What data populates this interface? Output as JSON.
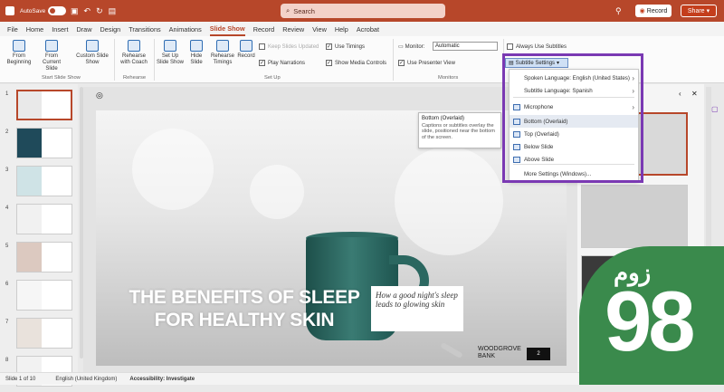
{
  "titlebar": {
    "autosave": "AutoSave",
    "search_placeholder": "Search",
    "record": "Record",
    "share": "Share"
  },
  "tabs": [
    "File",
    "Home",
    "Insert",
    "Draw",
    "Design",
    "Transitions",
    "Animations",
    "Slide Show",
    "Record",
    "Review",
    "View",
    "Help",
    "Acrobat"
  ],
  "active_tab": "Slide Show",
  "ribbon": {
    "from_beginning": "From Beginning",
    "from_current": "From Current Slide",
    "custom": "Custom Slide Show",
    "rehearse_coach": "Rehearse with Coach",
    "setup_show": "Set Up Slide Show",
    "hide_slide": "Hide Slide",
    "rehearse_timings": "Rehearse Timings",
    "record": "Record",
    "keep_updated": "Keep Slides Updated",
    "play_narrations": "Play Narrations",
    "use_timings": "Use Timings",
    "show_media": "Show Media Controls",
    "monitor_label": "Monitor:",
    "monitor_value": "Automatic",
    "presenter_view": "Use Presenter View",
    "always_subtitles": "Always Use Subtitles",
    "subtitle_settings": "Subtitle Settings",
    "groups": {
      "start": "Start Slide Show",
      "rehearse": "Rehearse",
      "setup": "Set Up",
      "monitors": "Monitors"
    }
  },
  "dropdown": {
    "items": [
      "Spoken Language: English (United States)",
      "Subtitle Language: Spanish",
      "Microphone",
      "Bottom (Overlaid)",
      "Top (Overlaid)",
      "Below Slide",
      "Above Slide",
      "More Settings (Windows)..."
    ]
  },
  "tooltip": {
    "title": "Bottom (Overlaid)",
    "body": "Captions or subtitles overlay the slide, positioned near the bottom of the screen."
  },
  "slide": {
    "title": "THE BENEFITS OF SLEEP FOR HEALTHY SKIN",
    "subtitle": "How a good night's sleep leads to glowing skin",
    "logo_line1": "WOODGROVE",
    "logo_line2": "BANK",
    "slide_number": "2"
  },
  "thumbnails": [
    "1",
    "2",
    "3",
    "4",
    "5",
    "6",
    "7",
    "8"
  ],
  "status": {
    "slide": "Slide 1 of 10",
    "language": "English (United Kingdom)",
    "accessibility": "Accessibility: Investigate"
  },
  "watermark": {
    "number": "98",
    "word": "زوم"
  },
  "colors": {
    "accent": "#b7472a",
    "highlight": "#7a39b3"
  }
}
